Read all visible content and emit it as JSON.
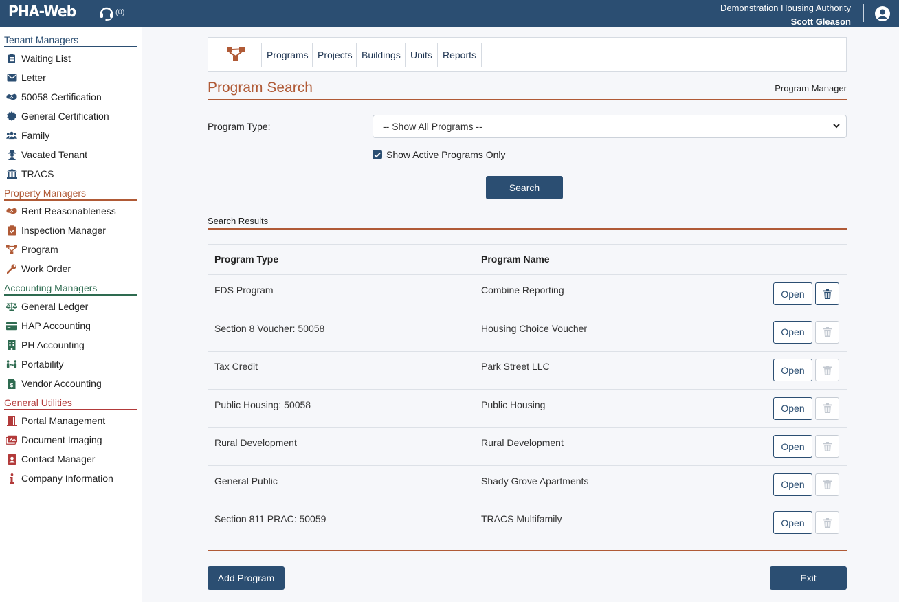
{
  "app": {
    "logo_text": "PHA-Web",
    "support_count": "(0)",
    "organization": "Demonstration Housing Authority",
    "user": "Scott Gleason",
    "colors": {
      "header": "#2b4e72",
      "accent": "#b05a36"
    }
  },
  "sidebar": {
    "sections": [
      {
        "title": "Tenant Managers",
        "color": "#2b4e72",
        "items": [
          {
            "label": "Waiting List",
            "icon": "clipboard-list-icon"
          },
          {
            "label": "Letter",
            "icon": "envelope-icon"
          },
          {
            "label": "50058 Certification",
            "icon": "handshake-icon"
          },
          {
            "label": "General Certification",
            "icon": "certificate-seal-icon"
          },
          {
            "label": "Family",
            "icon": "users-icon"
          },
          {
            "label": "Vacated Tenant",
            "icon": "user-secret-icon"
          },
          {
            "label": "TRACS",
            "icon": "bank-building-icon"
          }
        ]
      },
      {
        "title": "Property Managers",
        "color": "#b05a36",
        "items": [
          {
            "label": "Rent Reasonableness",
            "icon": "handshake-icon"
          },
          {
            "label": "Inspection Manager",
            "icon": "clipboard-check-icon"
          },
          {
            "label": "Program",
            "icon": "sitemap-icon"
          },
          {
            "label": "Work Order",
            "icon": "wrench-icon"
          }
        ]
      },
      {
        "title": "Accounting Managers",
        "color": "#2e6b50",
        "items": [
          {
            "label": "General Ledger",
            "icon": "balance-scale-icon"
          },
          {
            "label": "HAP Accounting",
            "icon": "credit-card-icon"
          },
          {
            "label": "PH Accounting",
            "icon": "building-icon"
          },
          {
            "label": "Portability",
            "icon": "people-arrows-icon"
          },
          {
            "label": "Vendor Accounting",
            "icon": "file-invoice-dollar-icon"
          }
        ]
      },
      {
        "title": "General Utilities",
        "color": "#b23a3a",
        "items": [
          {
            "label": "Portal Management",
            "icon": "door-open-icon"
          },
          {
            "label": "Document Imaging",
            "icon": "images-icon"
          },
          {
            "label": "Contact Manager",
            "icon": "address-book-icon"
          },
          {
            "label": "Company Information",
            "icon": "info-icon"
          }
        ]
      }
    ]
  },
  "toolbar": {
    "icon": "sitemap-icon",
    "tabs": [
      "Programs",
      "Projects",
      "Buildings",
      "Units",
      "Reports"
    ]
  },
  "page": {
    "title": "Program Search",
    "subtitle": "Program Manager"
  },
  "form": {
    "program_type_label": "Program Type:",
    "program_type_value": "-- Show All Programs --",
    "active_only_label": "Show Active Programs Only",
    "active_only_checked": true,
    "search_label": "Search"
  },
  "results": {
    "heading": "Search Results",
    "columns": [
      "Program Type",
      "Program Name"
    ],
    "open_label": "Open",
    "rows": [
      {
        "type": "FDS Program",
        "name": "Combine Reporting",
        "delete_enabled": true
      },
      {
        "type": "Section 8 Voucher: 50058",
        "name": "Housing Choice Voucher",
        "delete_enabled": false
      },
      {
        "type": "Tax Credit",
        "name": "Park Street LLC",
        "delete_enabled": false
      },
      {
        "type": "Public Housing: 50058",
        "name": "Public Housing",
        "delete_enabled": false
      },
      {
        "type": "Rural Development",
        "name": "Rural Development",
        "delete_enabled": false
      },
      {
        "type": "General Public",
        "name": "Shady Grove Apartments",
        "delete_enabled": false
      },
      {
        "type": "Section 811 PRAC: 50059",
        "name": "TRACS Multifamily",
        "delete_enabled": false
      }
    ]
  },
  "footer": {
    "add_label": "Add Program",
    "exit_label": "Exit"
  }
}
